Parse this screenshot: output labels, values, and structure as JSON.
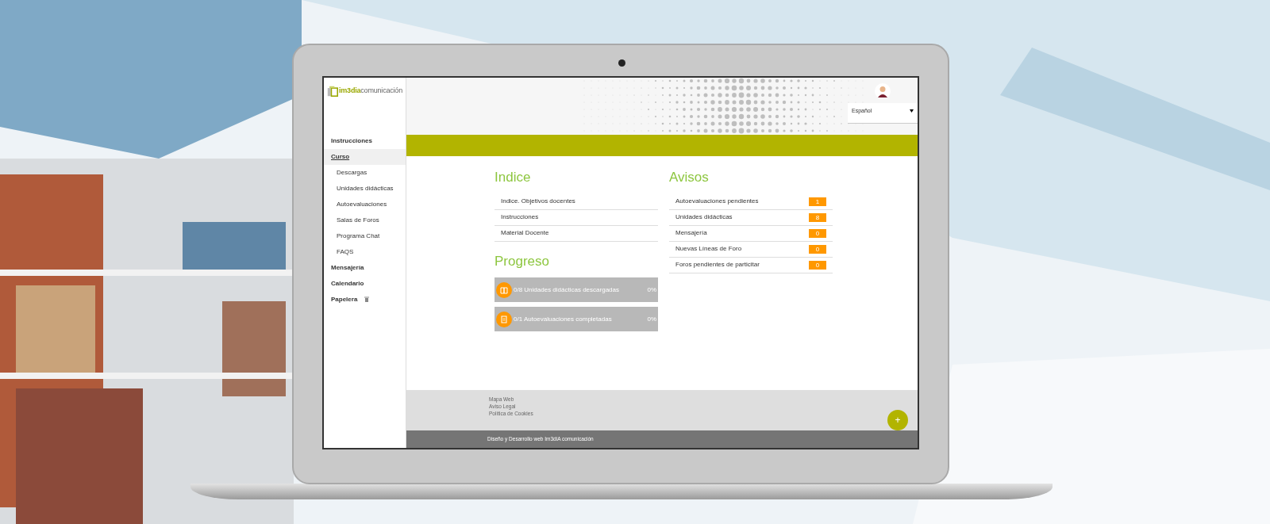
{
  "logo": {
    "text_1": "im3dia",
    "text_2": "comunicación"
  },
  "sidebar": {
    "items": [
      {
        "label": "Instrucciones",
        "kind": "plain",
        "selected": false
      },
      {
        "label": "Curso",
        "kind": "plain",
        "selected": true,
        "children": [
          {
            "label": "Descargas"
          },
          {
            "label": "Unidades didácticas"
          },
          {
            "label": "Autoevaluaciones"
          },
          {
            "label": "Salas de Foros"
          },
          {
            "label": "Programa Chat"
          },
          {
            "label": "FAQS"
          }
        ]
      },
      {
        "label": "Mensajería",
        "kind": "plain",
        "selected": false
      },
      {
        "label": "Calendario",
        "kind": "plain",
        "selected": false
      },
      {
        "label": "Papelera",
        "kind": "trash",
        "selected": false
      }
    ]
  },
  "header": {
    "language": "Español"
  },
  "indice": {
    "title": "Indice",
    "items": [
      "Indice. Objetivos docentes",
      "Instrucciones",
      "Material Docente"
    ]
  },
  "progreso": {
    "title": "Progreso",
    "items": [
      {
        "kind": "book",
        "label": "0/8 Unidades didácticas descargadas",
        "reading": "0%",
        "level": 0
      },
      {
        "kind": "form",
        "label": "0/1 Autoevaluaciones completadas",
        "reading": "0%",
        "level": 0
      }
    ]
  },
  "avisos": {
    "title": "Avisos",
    "items": [
      {
        "label": "Autoevaluaciones pendientes",
        "count": "1"
      },
      {
        "label": "Unidades didácticas",
        "count": "8"
      },
      {
        "label": "Mensajería",
        "count": "0"
      },
      {
        "label": "Nuevas Líneas de Foro",
        "count": "0"
      },
      {
        "label": "Foros pendientes de particitar",
        "count": "0"
      }
    ]
  },
  "footer": {
    "links": [
      "Mapa Web",
      "Aviso Legal",
      "Política de Cookies"
    ],
    "credit": "Diseño y Desarrollo web Im3diA comunicación"
  },
  "fab": {
    "label": "+"
  }
}
